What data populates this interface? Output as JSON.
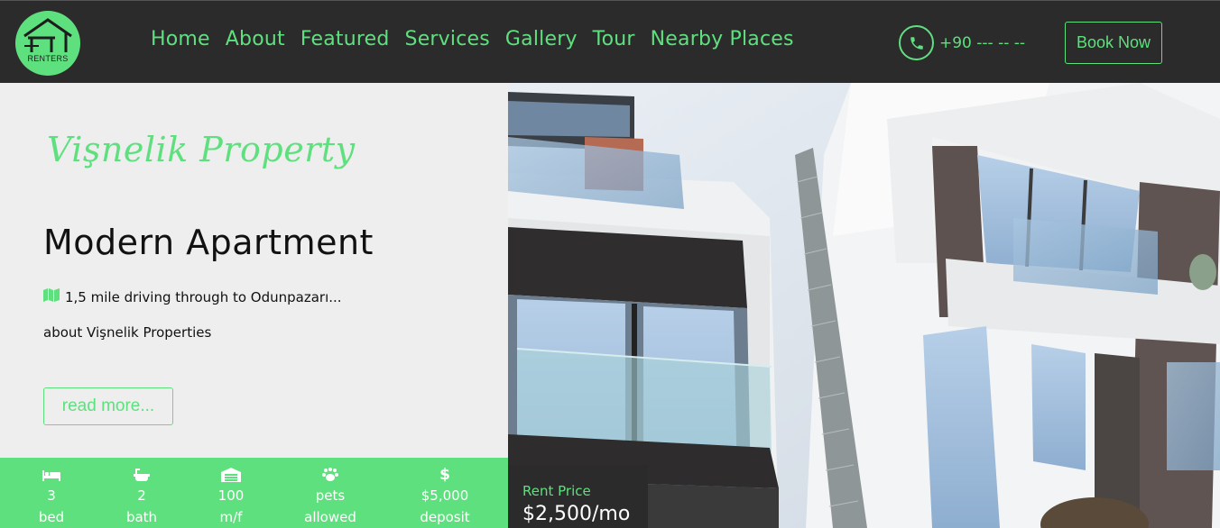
{
  "brand": {
    "logo_text": "RENTERS"
  },
  "nav": {
    "items": [
      "Home",
      "About",
      "Featured",
      "Services",
      "Gallery",
      "Tour",
      "Nearby Places"
    ]
  },
  "contact": {
    "phone": "+90 --- -- --",
    "book_label": "Book Now"
  },
  "hero": {
    "script_title": "Vişnelik Property",
    "title": "Modern Apartment",
    "distance": "1,5 mile driving through to Odunpazarı...",
    "about": "about Vişnelik Properties",
    "read_more": "read more..."
  },
  "features": [
    {
      "icon": "bed-icon",
      "value": "3",
      "label": "bed"
    },
    {
      "icon": "bath-icon",
      "value": "2",
      "label": "bath"
    },
    {
      "icon": "garage-icon",
      "value": "100",
      "label": "m/f"
    },
    {
      "icon": "paw-icon",
      "value": "pets",
      "label": "allowed"
    },
    {
      "icon": "dollar-icon",
      "value": "$5,000",
      "label": "deposit"
    }
  ],
  "price": {
    "label": "Rent Price",
    "value": "$2,500/mo"
  },
  "colors": {
    "accent": "#5fe07e",
    "dark": "#2b2b2b",
    "light_panel": "#eeeeee"
  }
}
